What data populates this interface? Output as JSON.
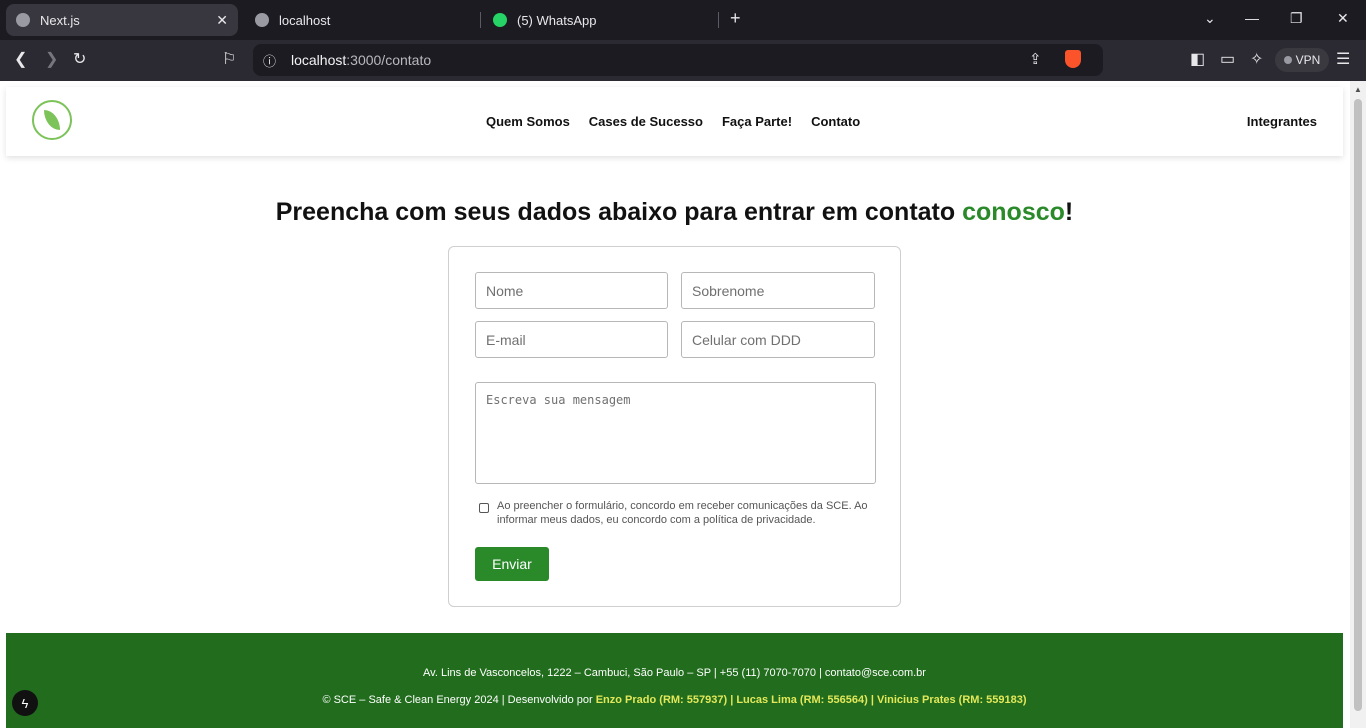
{
  "browser": {
    "tabs": [
      {
        "title": "Next.js",
        "active": true
      },
      {
        "title": "localhost",
        "active": false
      },
      {
        "title": "(5) WhatsApp",
        "active": false
      }
    ],
    "url_host": "localhost",
    "url_path": ":3000/contato",
    "vpn_label": "VPN"
  },
  "header": {
    "nav": [
      "Quem Somos",
      "Cases de Sucesso",
      "Faça Parte!",
      "Contato"
    ],
    "right_link": "Integrantes"
  },
  "headline": {
    "text": "Preencha com seus dados abaixo para entrar em contato ",
    "highlight": "conosco",
    "suffix": "!"
  },
  "form": {
    "first_name_placeholder": "Nome",
    "last_name_placeholder": "Sobrenome",
    "email_placeholder": "E-mail",
    "phone_placeholder": "Celular com DDD",
    "message_placeholder": "Escreva sua mensagem",
    "consent": "Ao preencher o formulário, concordo em receber comunicações da SCE. Ao informar meus dados, eu concordo com a política de privacidade.",
    "submit": "Enviar"
  },
  "footer": {
    "address": "Av. Lins de Vasconcelos, 1222 – Cambuci, São Paulo – SP | +55 (11) 7070-7070 | contato@sce.com.br",
    "copyright": "© SCE – Safe & Clean Energy 2024 | Desenvolvido por ",
    "authors": "Enzo Prado (RM: 557937) | Lucas Lima (RM: 556564) | Vinicius Prates (RM: 559183)"
  },
  "colors": {
    "accent": "#2a8a2a",
    "footer_bg": "#216d1d",
    "author_highlight": "#e3e85a"
  }
}
